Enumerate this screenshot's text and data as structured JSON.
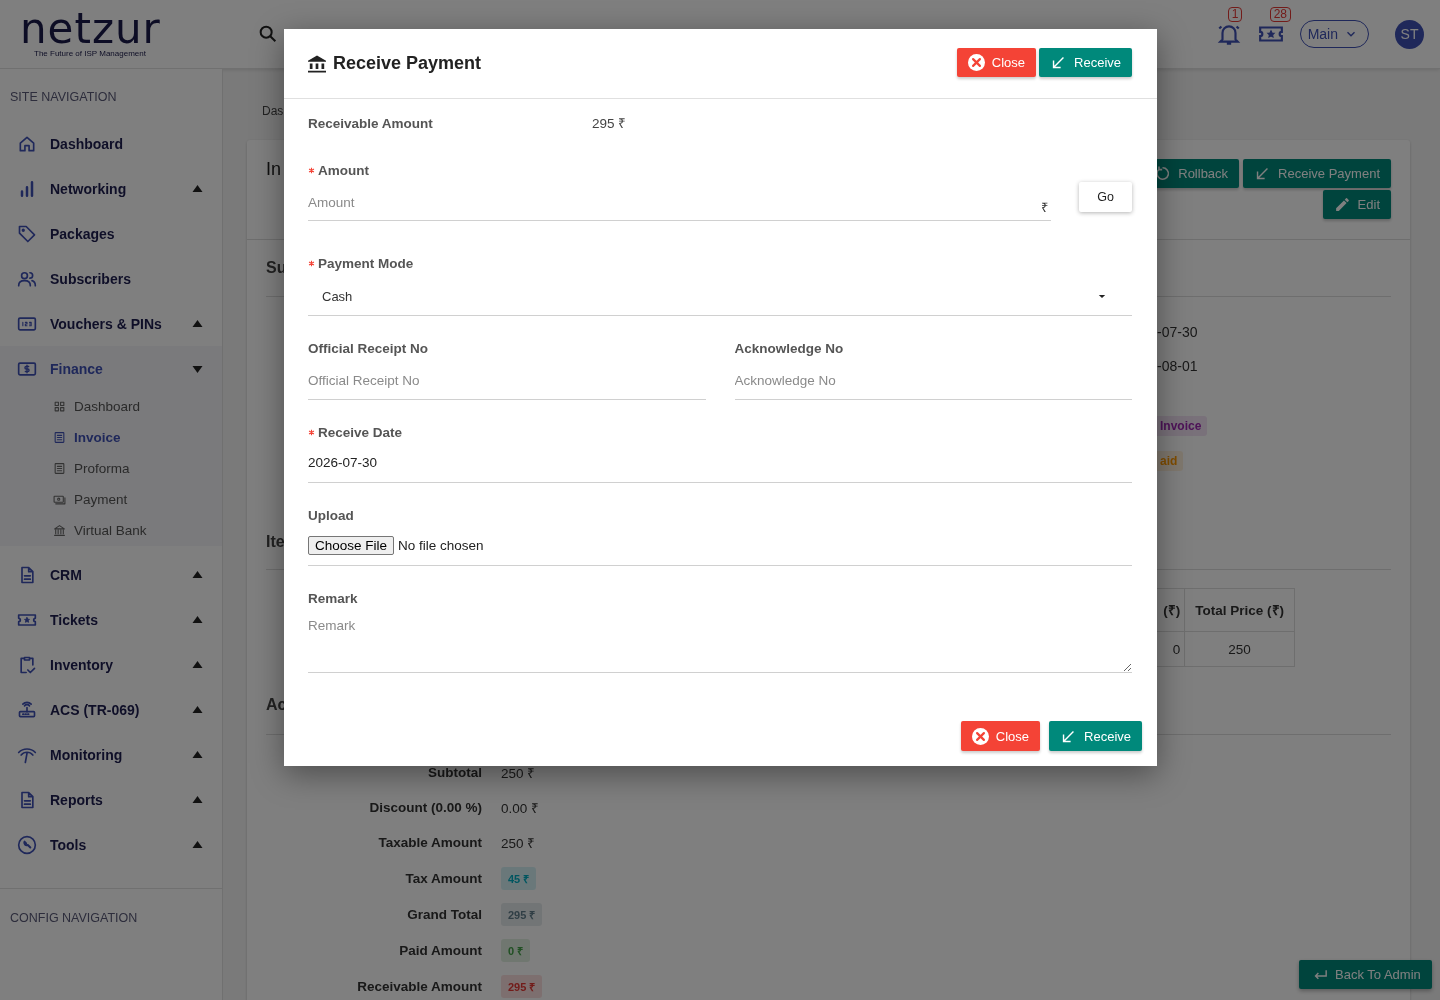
{
  "header": {
    "logo": "netzur",
    "tagline": "The Future of ISP Management",
    "notification_count": "1",
    "ticket_count": "28",
    "workspace": "Main",
    "avatar": "ST"
  },
  "sidebar": {
    "heading": "SITE NAVIGATION",
    "items": [
      {
        "label": "Dashboard",
        "expandable": false,
        "selected": false
      },
      {
        "label": "Networking",
        "expandable": true,
        "expanded": false,
        "selected": false
      },
      {
        "label": "Packages",
        "expandable": false,
        "selected": false
      },
      {
        "label": "Subscribers",
        "expandable": false,
        "selected": false
      },
      {
        "label": "Vouchers & PINs",
        "expandable": true,
        "expanded": false,
        "selected": false
      },
      {
        "label": "Finance",
        "expandable": true,
        "expanded": true,
        "selected": true,
        "children": [
          {
            "label": "Dashboard",
            "selected": false
          },
          {
            "label": "Invoice",
            "selected": true
          },
          {
            "label": "Proforma",
            "selected": false
          },
          {
            "label": "Payment",
            "selected": false
          },
          {
            "label": "Virtual Bank",
            "selected": false
          }
        ]
      },
      {
        "label": "CRM",
        "expandable": true,
        "expanded": false,
        "selected": false
      },
      {
        "label": "Tickets",
        "expandable": true,
        "expanded": false,
        "selected": false
      },
      {
        "label": "Inventory",
        "expandable": true,
        "expanded": false,
        "selected": false
      },
      {
        "label": "ACS (TR-069)",
        "expandable": true,
        "expanded": false,
        "selected": false
      },
      {
        "label": "Monitoring",
        "expandable": true,
        "expanded": false,
        "selected": false
      },
      {
        "label": "Reports",
        "expandable": true,
        "expanded": false,
        "selected": false
      },
      {
        "label": "Tools",
        "expandable": true,
        "expanded": false,
        "selected": false
      }
    ],
    "config_heading": "CONFIG NAVIGATION"
  },
  "breadcrumb": "Das",
  "card": {
    "title": "In",
    "buttons": [
      {
        "label": "Rollback",
        "kind": "rollback"
      },
      {
        "label": "Receive Payment",
        "kind": "receive"
      },
      {
        "label": "Edit",
        "kind": "edit"
      }
    ],
    "section_1": "Su",
    "dates": [
      "-07-30",
      "-08-01"
    ],
    "tags": [
      {
        "text": "Invoice",
        "kind": "type"
      },
      {
        "text": "aid",
        "kind": "status"
      }
    ],
    "section_2": "Ite",
    "table": {
      "columns": [
        "(₹)",
        "Total Price (₹)"
      ],
      "rows": [
        [
          "0",
          "250"
        ]
      ]
    },
    "section_3": "Ac",
    "summary": [
      {
        "label": "Subtotal",
        "value": "250 ₹",
        "kind": "plain"
      },
      {
        "label": "Discount (0.00 %)",
        "value": "0.00 ₹",
        "kind": "plain"
      },
      {
        "label": "Taxable Amount",
        "value": "250 ₹",
        "kind": "plain"
      },
      {
        "label": "Tax Amount",
        "value": "45 ₹",
        "kind": "info"
      },
      {
        "label": "Grand Total",
        "value": "295 ₹",
        "kind": "neutral"
      },
      {
        "label": "Paid Amount",
        "value": "0 ₹",
        "kind": "success"
      },
      {
        "label": "Receivable Amount",
        "value": "295 ₹",
        "kind": "danger"
      }
    ]
  },
  "back_button": "Back To Admin",
  "modal": {
    "title": "Receive Payment",
    "header_buttons": [
      {
        "label": "Close",
        "kind": "close"
      },
      {
        "label": "Receive",
        "kind": "receive"
      }
    ],
    "receivable": {
      "label": "Receivable Amount",
      "value": "295 ₹"
    },
    "amount": {
      "label": "Amount",
      "required": true,
      "placeholder": "Amount",
      "suffix": "₹",
      "button": "Go"
    },
    "payment_mode": {
      "label": "Payment Mode",
      "required": true,
      "value": "Cash"
    },
    "official_receipt": {
      "label": "Official Receipt No",
      "placeholder": "Official Receipt No"
    },
    "acknowledge": {
      "label": "Acknowledge No",
      "placeholder": "Acknowledge No"
    },
    "receive_date": {
      "label": "Receive Date",
      "required": true,
      "value": "2026-07-30"
    },
    "upload": {
      "label": "Upload",
      "button": "Choose File",
      "status": "No file chosen"
    },
    "remark": {
      "label": "Remark",
      "placeholder": "Remark"
    },
    "footer_buttons": [
      {
        "label": "Close",
        "kind": "close"
      },
      {
        "label": "Receive",
        "kind": "receive"
      }
    ]
  }
}
